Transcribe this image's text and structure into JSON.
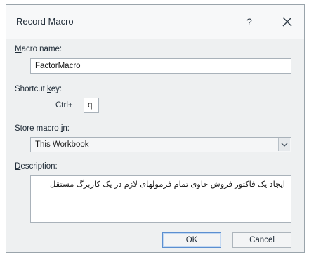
{
  "window": {
    "title": "Record Macro",
    "help_label": "?",
    "close_icon": "close-icon"
  },
  "macro_name": {
    "label_accel": "M",
    "label_rest": "acro name:",
    "value": "FactorMacro"
  },
  "shortcut_key": {
    "label_pre": "Shortcut ",
    "label_accel": "k",
    "label_rest": "ey:",
    "prefix": "Ctrl+",
    "value": "q"
  },
  "store_macro": {
    "label_pre": "Store macro ",
    "label_accel": "i",
    "label_rest": "n:",
    "selected": "This Workbook",
    "arrow_icon": "chevron-down-icon"
  },
  "description": {
    "label_accel": "D",
    "label_rest": "escription:",
    "value": "ایجاد یک فاکتور فروش حاوی تمام فرمولهای لازم در یک کاربرگ مستقل"
  },
  "buttons": {
    "ok_label": "OK",
    "cancel_label": "Cancel"
  },
  "colors": {
    "dialog_bg": "#eef0f1",
    "default_button_border": "#5b8fd0"
  }
}
